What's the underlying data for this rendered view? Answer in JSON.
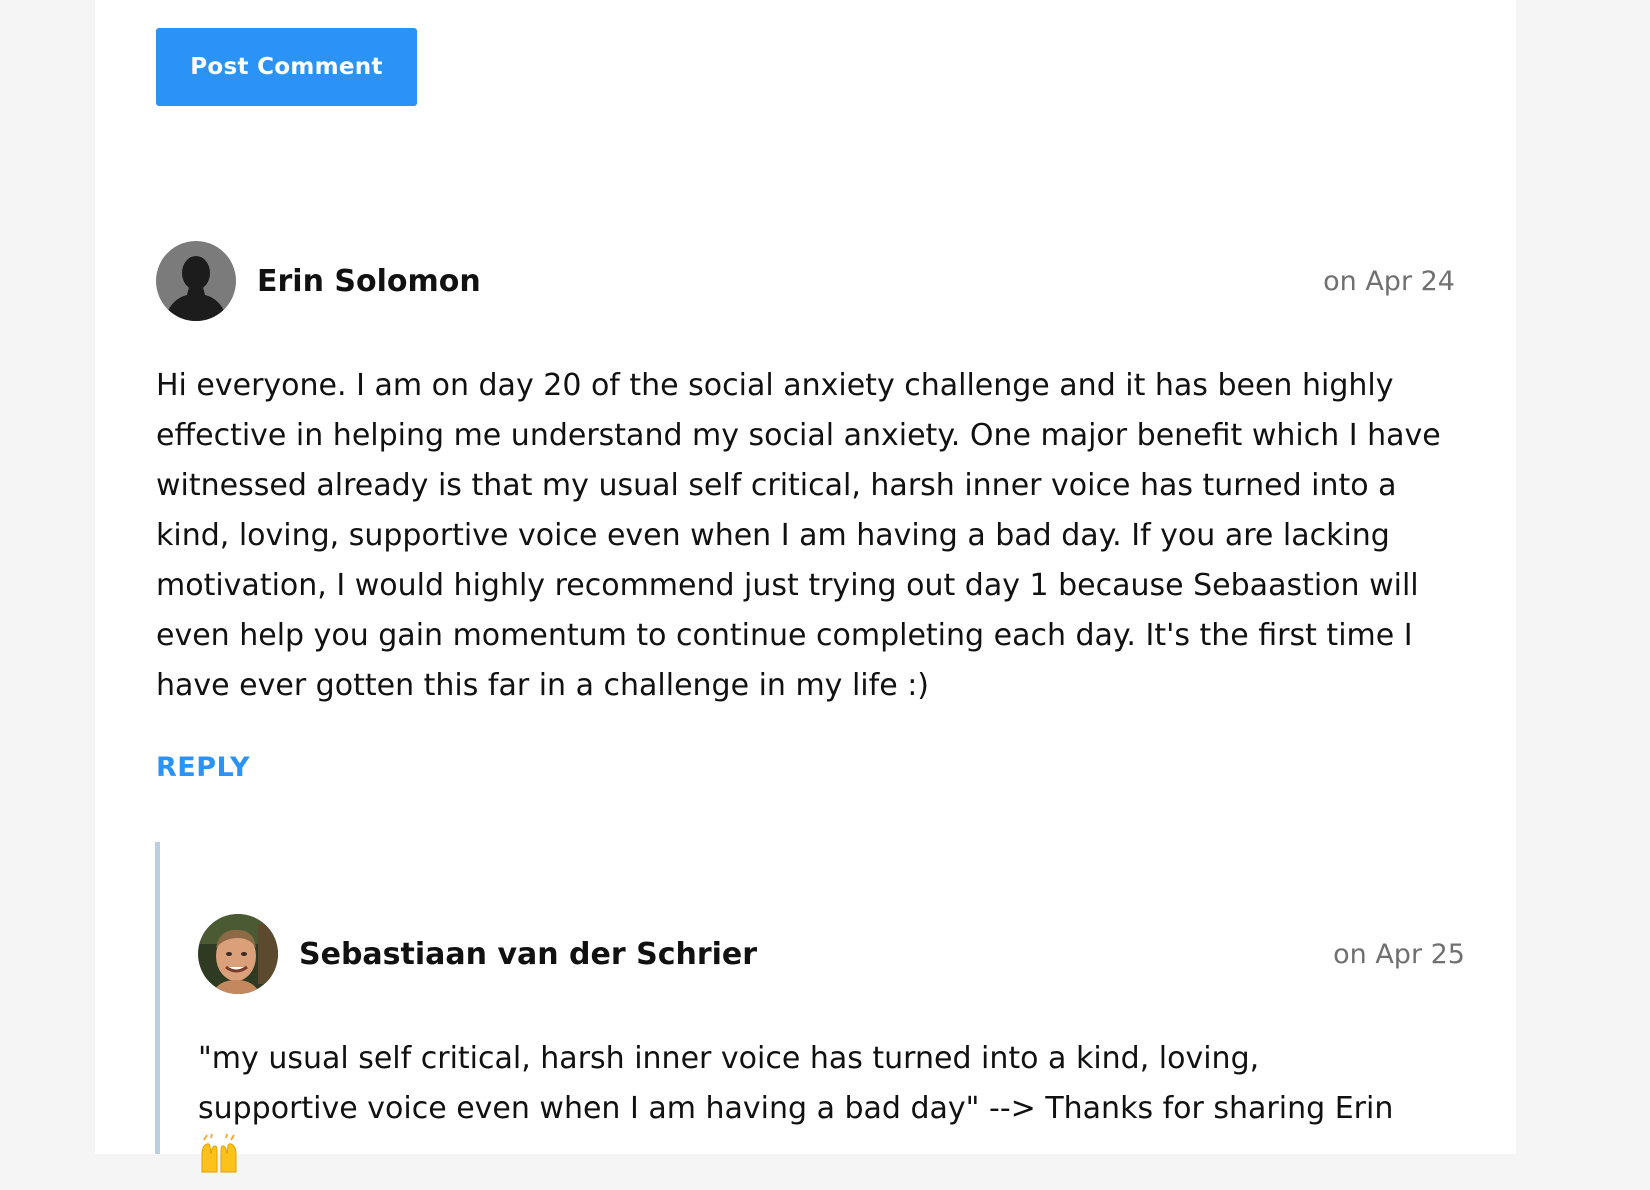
{
  "comment_form": {
    "post_button_label": "Post Comment"
  },
  "comments": [
    {
      "author": "Erin Solomon",
      "date": "on Apr 24",
      "avatar_icon": "default-user-silhouette",
      "body": "Hi everyone. I am on day 20 of the social anxiety challenge and it has been highly effective in helping me understand my social anxiety. One major benefit which I have witnessed already is that my usual self critical, harsh inner voice has turned into a kind, loving, supportive voice even when I am having a bad day. If you are lacking motivation, I would highly recommend just trying out day 1 because Sebaastion will even help you gain momentum to continue completing each day. It's the first time I have ever gotten this far in a challenge in my life :)",
      "reply_label": "REPLY",
      "replies": [
        {
          "author": "Sebastiaan van der Schrier",
          "date": "on Apr 25",
          "avatar_icon": "user-photo",
          "body": "\"my usual self critical, harsh inner voice has turned into a kind, loving, supportive voice even when I am having a bad day\" --> Thanks for sharing Erin",
          "emoji": "raising-hands-emoji"
        }
      ]
    }
  ],
  "colors": {
    "accent": "#2b93f5",
    "date_text": "#707070",
    "thread_line": "#b8d0e6",
    "page_background": "#f5f5f5",
    "card_background": "#ffffff"
  }
}
